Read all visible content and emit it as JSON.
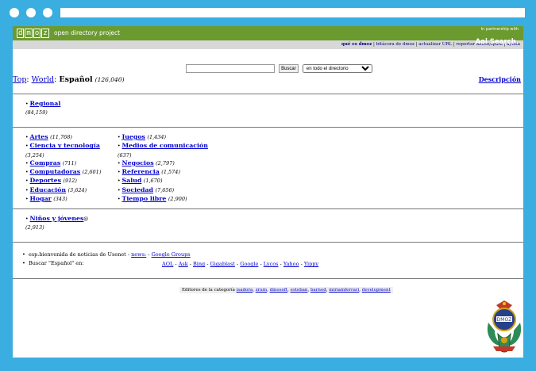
{
  "header": {
    "logo_letters": [
      "d",
      "m",
      "o",
      "z"
    ],
    "tagline": "open directory project",
    "partner_small": "In partnership with",
    "partner_name": "Aol Search."
  },
  "subnav": {
    "items": [
      "qué es dmoz",
      "bitácora de dmoz",
      "actualizar URL",
      "reportar abuso/spam",
      "ayuda"
    ]
  },
  "search": {
    "button": "Buscar",
    "scope": "en todo el directorio"
  },
  "breadcrumb": {
    "top": "Top",
    "world": "World",
    "current": "Español",
    "count": "(126,040)"
  },
  "description_link": "Descripción",
  "regional": {
    "label": "Regional",
    "count": "(84,159)"
  },
  "categories_left": [
    {
      "label": "Artes",
      "count": "(11,768)"
    },
    {
      "label": "Ciencia y tecnología",
      "count": "(3,254)"
    },
    {
      "label": "Compras",
      "count": "(711)"
    },
    {
      "label": "Computadoras",
      "count": "(2,601)"
    },
    {
      "label": "Deportes",
      "count": "(912)"
    },
    {
      "label": "Educación",
      "count": "(3,624)"
    },
    {
      "label": "Hogar",
      "count": "(343)"
    }
  ],
  "categories_right": [
    {
      "label": "Juegos",
      "count": "(1,434)"
    },
    {
      "label": "Medios de comunicación",
      "count": "(637)"
    },
    {
      "label": "Negocios",
      "count": "(2,797)"
    },
    {
      "label": "Referencia",
      "count": "(1,574)"
    },
    {
      "label": "Salud",
      "count": "(1,670)"
    },
    {
      "label": "Sociedad",
      "count": "(7,656)"
    },
    {
      "label": "Tiempo libre",
      "count": "(2,900)"
    }
  ],
  "kids": {
    "label": "Niños y jóvenes",
    "count": "(2,913)"
  },
  "usenet": {
    "text": "esp.bienvenida de noticias de Usenet - ",
    "news": "news:",
    "sep": " - ",
    "groups": "Google Groups"
  },
  "search_other": {
    "text": "Buscar \"Español\" en:",
    "engines": [
      "AOL",
      "Ask",
      "Bing",
      "Gigablast",
      "Google",
      "Lycos",
      "Yahoo",
      "Yippy"
    ]
  },
  "editors": {
    "text": "Editores de la categoría ",
    "names": [
      "isadora",
      "zrum",
      "dinosoft",
      "esteban",
      "barned",
      "miriamferrari",
      "development"
    ]
  }
}
